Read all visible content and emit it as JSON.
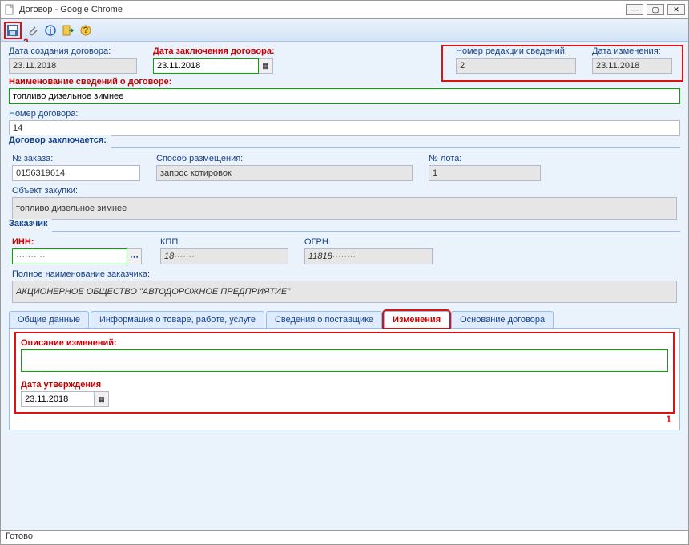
{
  "window": {
    "title": "Договор - Google Chrome"
  },
  "annot": {
    "a1": "1",
    "a2": "2"
  },
  "top": {
    "createDateLabel": "Дата создания договора:",
    "createDate": "23.11.2018",
    "signDateLabel": "Дата заключения договора:",
    "signDate": "23.11.2018",
    "revNumLabel": "Номер редакции сведений:",
    "revNum": "2",
    "changeDateLabel": "Дата изменения:",
    "changeDate": "23.11.2018"
  },
  "info": {
    "nameLabel": "Наименование сведений о договоре:",
    "name": "топливо дизельное зимнее",
    "numLabel": "Номер договора:",
    "num": "14"
  },
  "deal": {
    "legend": "Договор заключается:",
    "orderLabel": "№ заказа:",
    "order": "0156319614",
    "methodLabel": "Способ размещения:",
    "method": "запрос котировок",
    "lotLabel": "№ лота:",
    "lot": "1",
    "objLabel": "Объект закупки:",
    "obj": "топливо дизельное зимнее"
  },
  "cust": {
    "legend": "Заказчик",
    "innLabel": "ИНН:",
    "inn": "··········",
    "kppLabel": "КПП:",
    "kpp": "18······· ",
    "ogrnLabel": "ОГРН:",
    "ogrn": "11818········",
    "fullLabel": "Полное наименование заказчика:",
    "full": "АКЦИОНЕРНОЕ ОБЩЕСТВО \"АВТОДОРОЖНОЕ ПРЕДПРИЯТИЕ\""
  },
  "tabs": {
    "t1": "Общие данные",
    "t2": "Информация о товаре, работе, услуге",
    "t3": "Сведения о поставщике",
    "t4": "Изменения",
    "t5": "Основание договора"
  },
  "changes": {
    "descLabel": "Описание изменений:",
    "desc": "",
    "approveLabel": "Дата утверждения",
    "approveDate": "23.11.2018"
  },
  "status": "Готово"
}
